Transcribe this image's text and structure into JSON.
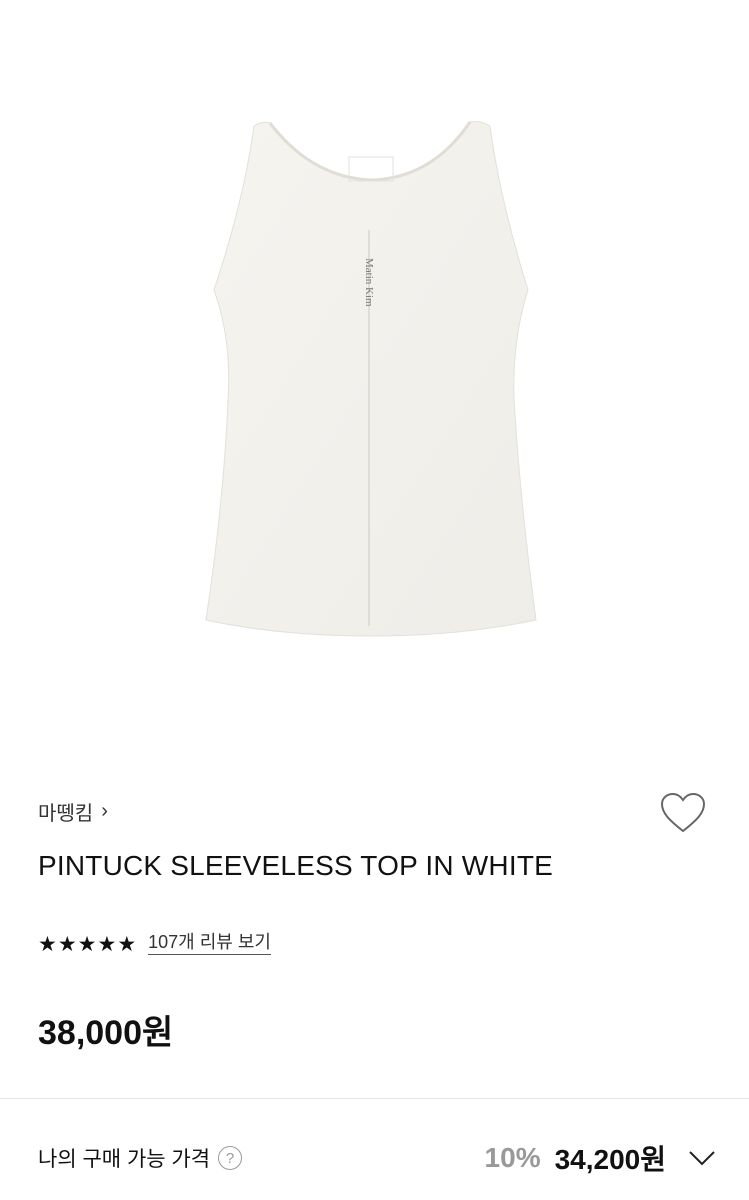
{
  "product": {
    "brand": "마뗑킴",
    "brand_chevron": "›",
    "title": "PINTUCK SLEEVELESS TOP IN WHITE",
    "rating_stars": 5,
    "review_link": "107개 리뷰 보기",
    "price": "38,000원",
    "image_label": "Matin Kim"
  },
  "purchase": {
    "my_price_label": "나의 구매 가능 가격",
    "help_icon": "?",
    "discount_rate": "10%",
    "discount_price": "34,200원"
  },
  "icons": {
    "wishlist": "heart-outline-icon",
    "expand": "chevron-down-icon",
    "star": "star-filled-icon"
  },
  "colors": {
    "text": "#111111",
    "muted": "#999999",
    "divider": "#e6e6e6",
    "garment": "#f3f1ec"
  }
}
